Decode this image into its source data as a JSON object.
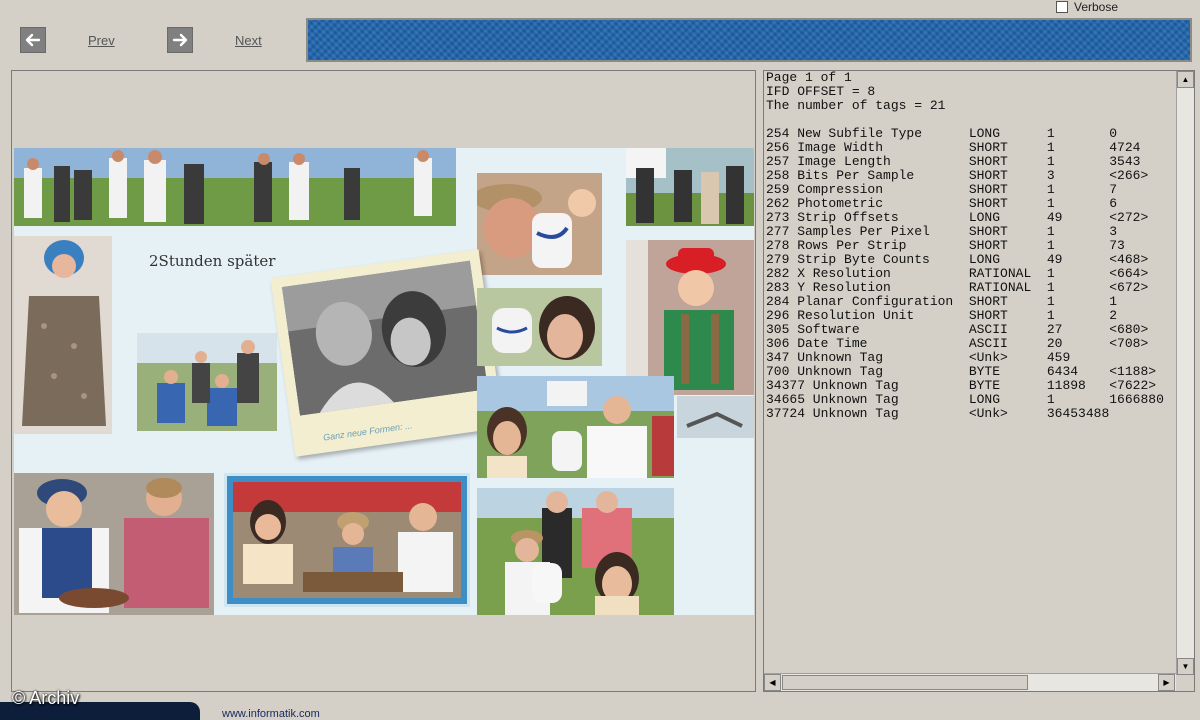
{
  "toolbar": {
    "prev_label": "Prev",
    "next_label": "Next",
    "verbose_label": "Verbose"
  },
  "collage": {
    "caption": "2Stunden später",
    "polaroid_caption": "Ganz neue Formen: ..."
  },
  "tiff_info": {
    "header_lines": [
      "Page 1 of 1",
      "IFD OFFSET = 8",
      "The number of tags = 21"
    ],
    "tags": [
      [
        "254",
        "New Subfile Type",
        "LONG",
        "1",
        "0"
      ],
      [
        "256",
        "Image Width",
        "SHORT",
        "1",
        "4724"
      ],
      [
        "257",
        "Image Length",
        "SHORT",
        "1",
        "3543"
      ],
      [
        "258",
        "Bits Per Sample",
        "SHORT",
        "3",
        "<266>"
      ],
      [
        "259",
        "Compression",
        "SHORT",
        "1",
        "7"
      ],
      [
        "262",
        "Photometric",
        "SHORT",
        "1",
        "6"
      ],
      [
        "273",
        "Strip Offsets",
        "LONG",
        "49",
        "<272>"
      ],
      [
        "277",
        "Samples Per Pixel",
        "SHORT",
        "1",
        "3"
      ],
      [
        "278",
        "Rows Per Strip",
        "SHORT",
        "1",
        "73"
      ],
      [
        "279",
        "Strip Byte Counts",
        "LONG",
        "49",
        "<468>"
      ],
      [
        "282",
        "X Resolution",
        "RATIONAL",
        "1",
        "<664>"
      ],
      [
        "283",
        "Y Resolution",
        "RATIONAL",
        "1",
        "<672>"
      ],
      [
        "284",
        "Planar Configuration",
        "SHORT",
        "1",
        "1"
      ],
      [
        "296",
        "Resolution Unit",
        "SHORT",
        "1",
        "2"
      ],
      [
        "305",
        "Software",
        "ASCII",
        "27",
        "<680>"
      ],
      [
        "306",
        "Date Time",
        "ASCII",
        "20",
        "<708>"
      ],
      [
        "347",
        "Unknown Tag",
        "<Unk>",
        "459",
        ""
      ],
      [
        "700",
        "Unknown Tag",
        "BYTE",
        "6434",
        "<1188>"
      ],
      [
        "34377",
        "Unknown Tag",
        "BYTE",
        "11898",
        "<7622>"
      ],
      [
        "34665",
        "Unknown Tag",
        "LONG",
        "1",
        "1666880"
      ],
      [
        "37724",
        "Unknown Tag",
        "<Unk>",
        "36453488",
        ""
      ]
    ]
  },
  "footer": {
    "archiv": "© Archiv",
    "website": "www.informatik.com"
  },
  "colors": {
    "background": "#d4d0c8",
    "banner": "#2a6db2",
    "collage_bg": "#e6f1f6"
  }
}
